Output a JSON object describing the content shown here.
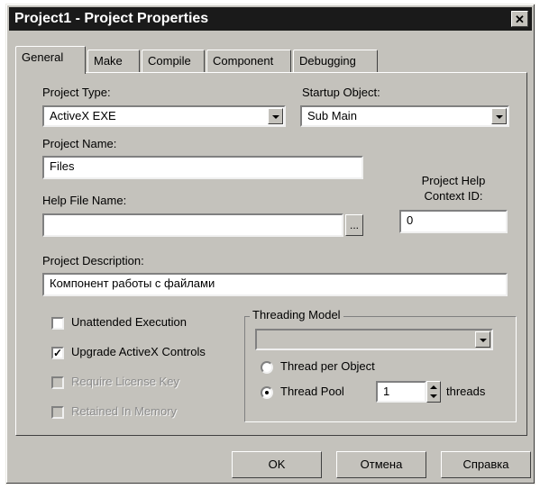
{
  "window": {
    "title": "Project1 - Project Properties",
    "close_glyph": "✕"
  },
  "tabs": [
    {
      "label": "General",
      "active": true
    },
    {
      "label": "Make"
    },
    {
      "label": "Compile"
    },
    {
      "label": "Component"
    },
    {
      "label": "Debugging"
    }
  ],
  "general": {
    "project_type_label": "Project Type:",
    "project_type_value": "ActiveX EXE",
    "startup_object_label": "Startup Object:",
    "startup_object_value": "Sub Main",
    "project_name_label": "Project Name:",
    "project_name_value": "Files",
    "help_file_label": "Help File Name:",
    "help_file_value": "",
    "browse_label": "...",
    "help_context_label_line1": "Project Help",
    "help_context_label_line2": "Context ID:",
    "help_context_value": "0",
    "description_label": "Project Description:",
    "description_value": "Компонент работы с файлами",
    "unattended_label": "Unattended Execution",
    "unattended_checked": false,
    "upgrade_label": "Upgrade ActiveX Controls",
    "upgrade_checked": true,
    "check_mark": "✓",
    "license_label": "Require License Key",
    "retained_label": "Retained In Memory"
  },
  "threading": {
    "group_label": "Threading Model",
    "model_value": "",
    "thread_per_object_label": "Thread per Object",
    "thread_pool_label": "Thread Pool",
    "selected": "thread_pool",
    "pool_value": "1",
    "threads_label": "threads"
  },
  "buttons": {
    "ok": "OK",
    "cancel": "Отмена",
    "help": "Справка"
  },
  "colors": {
    "face": "#c4c2bc",
    "titlebar": "#1a1a1a"
  }
}
